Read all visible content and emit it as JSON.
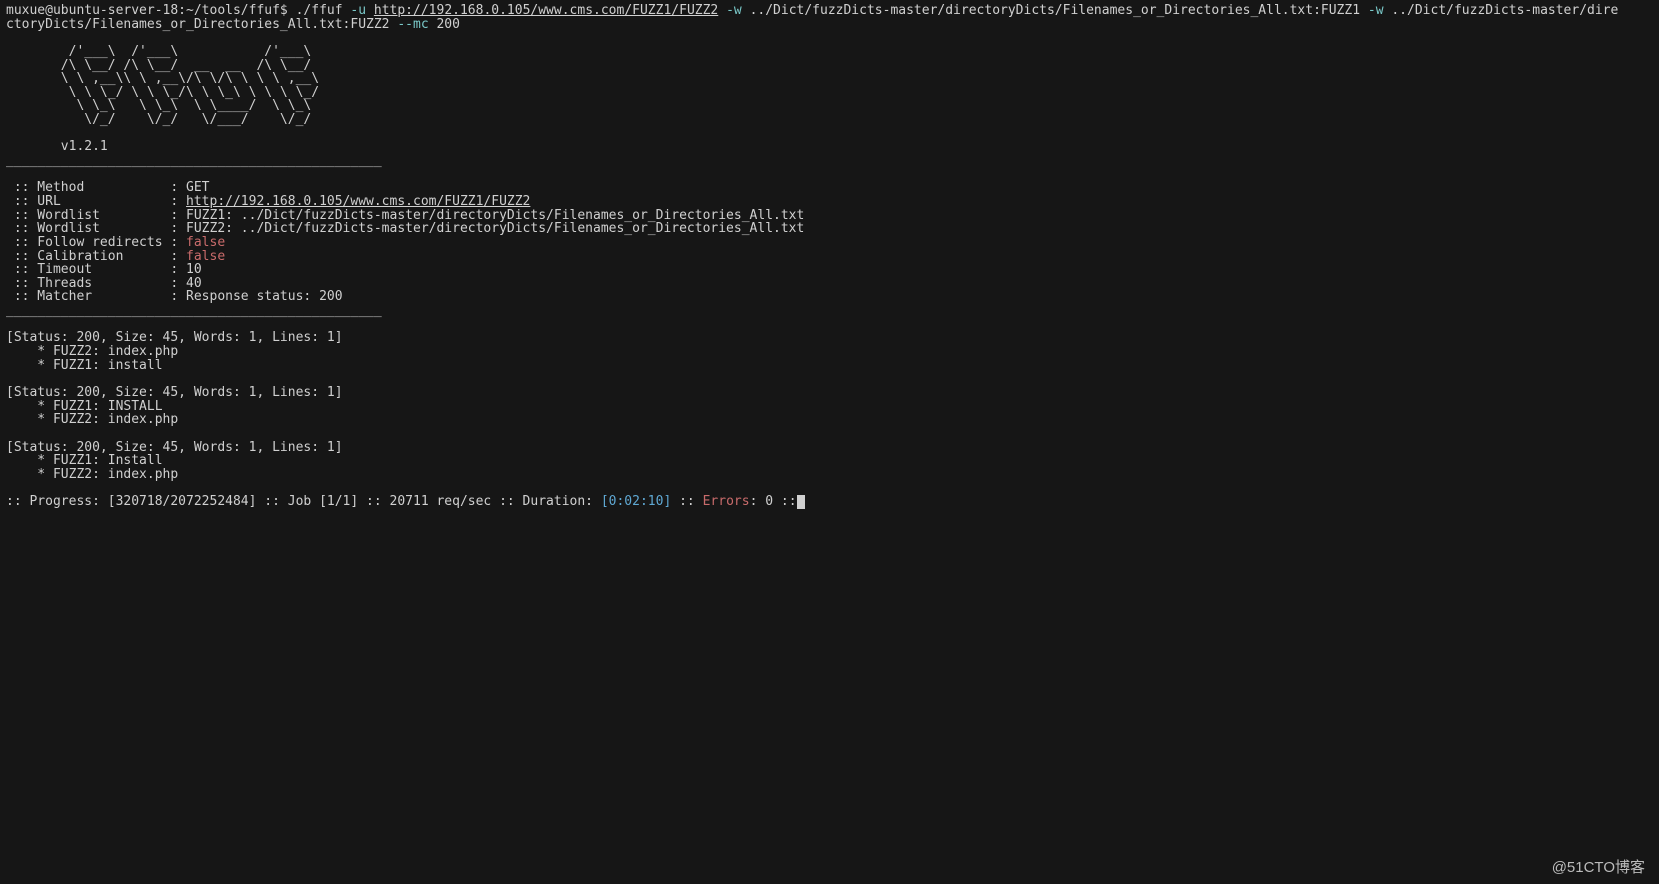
{
  "prompt": {
    "user_host_path": "muxue@ubuntu-server-18:~/tools/ffuf$ ",
    "cmd": "./ffuf",
    "flag_u": "-u",
    "url": "http://192.168.0.105/www.cms.com/FUZZ1/FUZZ2",
    "flag_w1": "-w",
    "wl1": "../Dict/fuzzDicts-master/directoryDicts/Filenames_or_Directories_All.txt:FUZZ1",
    "flag_w2": "-w",
    "wl2_a": "../Dict/fuzzDicts-master/dire",
    "wl2_b": "ctoryDicts/Filenames_or_Directories_All.txt:FUZZ2",
    "flag_mc": "--mc",
    "mc_val": "200"
  },
  "ascii": {
    "l1": "        /'___\\  /'___\\           /'___\\",
    "l2": "       /\\ \\__/ /\\ \\__/  __  __  /\\ \\__/",
    "l3": "       \\ \\ ,__\\\\ \\ ,__\\/\\ \\/\\ \\ \\ \\ ,__\\",
    "l4": "        \\ \\ \\_/ \\ \\ \\_/\\ \\ \\_\\ \\ \\ \\ \\_/",
    "l5": "         \\ \\_\\   \\ \\_\\  \\ \\____/  \\ \\_\\",
    "l6": "          \\/_/    \\/_/   \\/___/    \\/_/"
  },
  "version": "       v1.2.1",
  "rule": "________________________________________________",
  "config": {
    "method_label": " :: Method           : ",
    "method_value": "GET",
    "url_label": " :: URL              : ",
    "url_value": "http://192.168.0.105/www.cms.com/FUZZ1/FUZZ2",
    "wl1_label": " :: Wordlist         : ",
    "wl1_value": "FUZZ1: ../Dict/fuzzDicts-master/directoryDicts/Filenames_or_Directories_All.txt",
    "wl2_label": " :: Wordlist         : ",
    "wl2_value": "FUZZ2: ../Dict/fuzzDicts-master/directoryDicts/Filenames_or_Directories_All.txt",
    "follow_label": " :: Follow redirects : ",
    "follow_value": "false",
    "calib_label": " :: Calibration      : ",
    "calib_value": "false",
    "timeout_label": " :: Timeout          : ",
    "timeout_value": "10",
    "threads_label": " :: Threads          : ",
    "threads_value": "40",
    "matcher_label": " :: Matcher          : ",
    "matcher_value": "Response status: 200"
  },
  "results": [
    {
      "status": "[Status: 200, Size: 45, Words: 1, Lines: 1]",
      "line1": "    * FUZZ2: index.php",
      "line2": "    * FUZZ1: install"
    },
    {
      "status": "[Status: 200, Size: 45, Words: 1, Lines: 1]",
      "line1": "    * FUZZ1: INSTALL",
      "line2": "    * FUZZ2: index.php"
    },
    {
      "status": "[Status: 200, Size: 45, Words: 1, Lines: 1]",
      "line1": "    * FUZZ1: Install",
      "line2": "    * FUZZ2: index.php"
    }
  ],
  "progress": {
    "pre": ":: Progress: [320718/2072252484] :: Job [1/1] :: 20711 req/sec :: Duration: ",
    "duration": "[0:02:10]",
    "mid": " :: ",
    "errors_label": "Errors",
    "errors_rest": ": 0 ::"
  },
  "watermark": "@51CTO博客"
}
